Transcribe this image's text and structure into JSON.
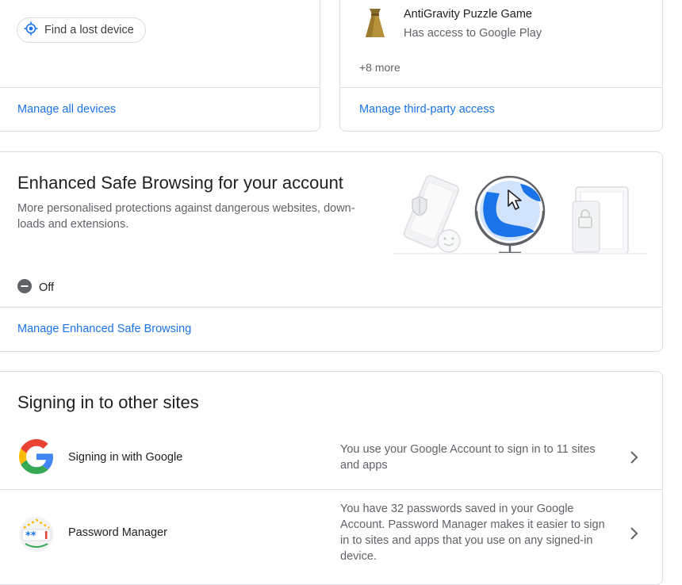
{
  "devices": {
    "find_device_label": "Find a lost device",
    "manage_link": "Manage all devices"
  },
  "third_party": {
    "app_name": "AntiGravity Puzzle Game",
    "app_access": "Has access to Google Play",
    "more": "+8 more",
    "manage_link": "Manage third-party access"
  },
  "safe_browsing": {
    "title": "Enhanced Safe Browsing for your account",
    "description": "More personalised protections against dangerous websites, down-loads and extensions.",
    "status": "Off",
    "manage_link": "Manage Enhanced Safe Browsing"
  },
  "signing_in": {
    "title": "Signing in to other sites",
    "rows": [
      {
        "title": "Signing in with Google",
        "description": "You use your Google Account to sign in to 11 sites and apps",
        "icon": "google-g-icon"
      },
      {
        "title": "Password Manager",
        "description": "You have 32 passwords saved in your Google Account. Password Manager makes it easier to sign in to sites and apps that you use on any signed-in device.",
        "icon": "password-manager-icon"
      }
    ]
  },
  "colors": {
    "accent": "#1a73e8",
    "border": "#dadce0",
    "text_primary": "#202124",
    "text_secondary": "#5f6368"
  }
}
